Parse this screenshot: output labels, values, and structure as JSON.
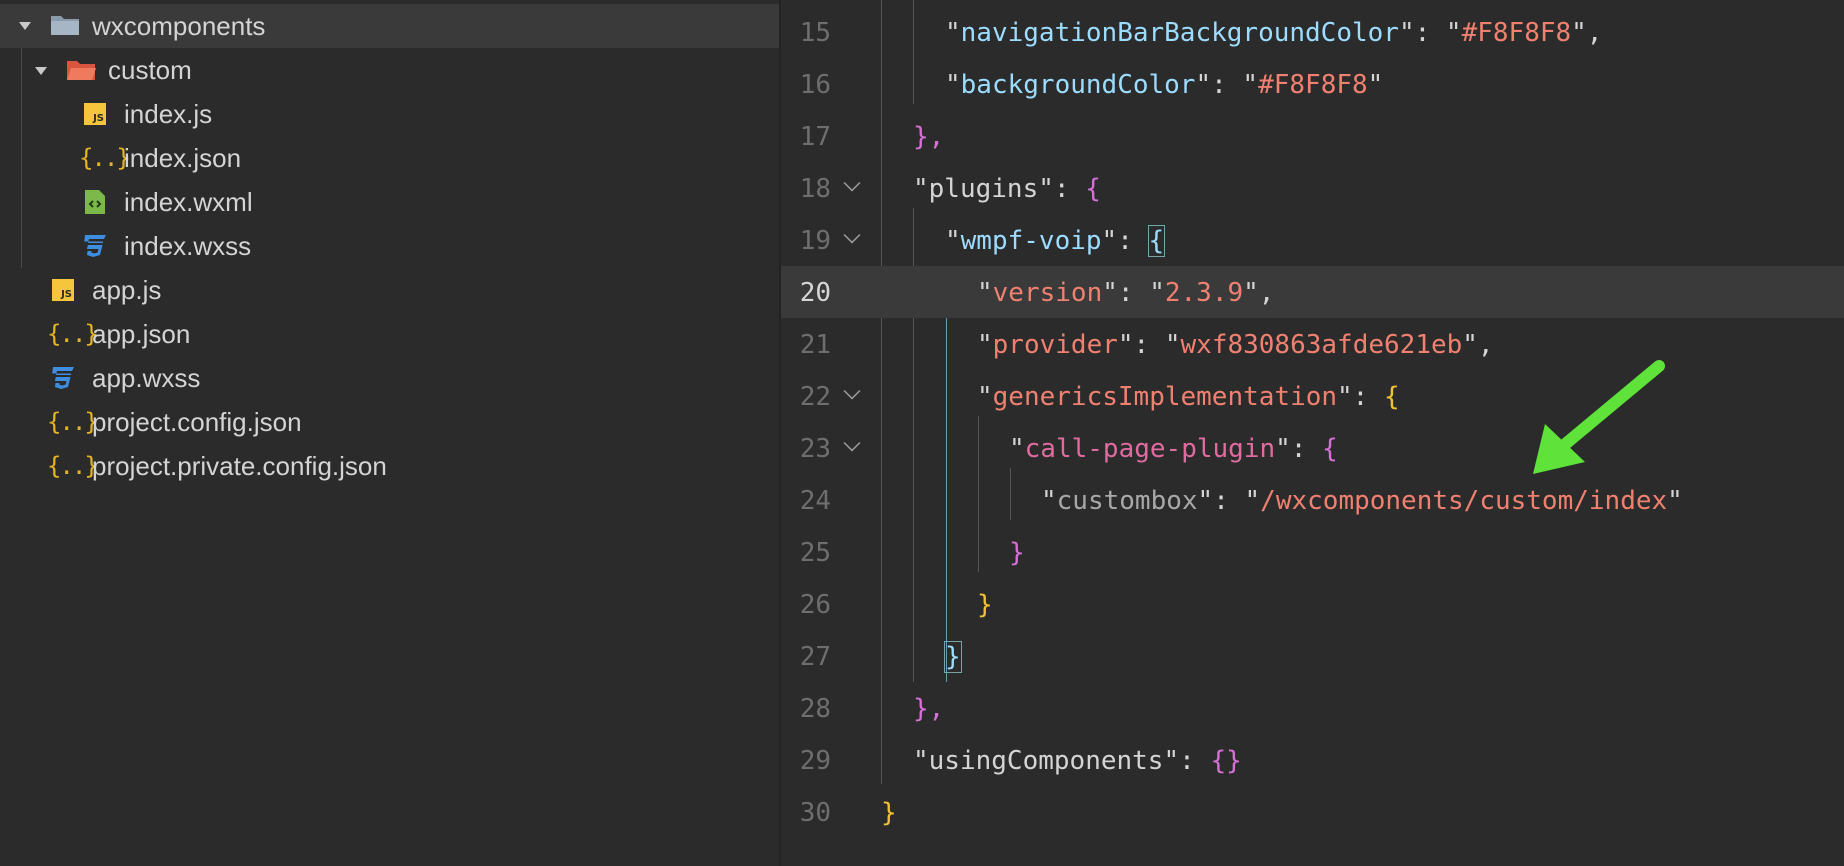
{
  "explorer": {
    "items": [
      {
        "label": "wxcomponents",
        "icon": "folder-icon",
        "expanded": true
      },
      {
        "label": "custom",
        "icon": "folder-open-icon",
        "expanded": true
      },
      {
        "label": "index.js",
        "icon": "js-file-icon"
      },
      {
        "label": "index.json",
        "icon": "json-file-icon"
      },
      {
        "label": "index.wxml",
        "icon": "wxml-file-icon"
      },
      {
        "label": "index.wxss",
        "icon": "css-file-icon"
      },
      {
        "label": "app.js",
        "icon": "js-file-icon"
      },
      {
        "label": "app.json",
        "icon": "json-file-icon"
      },
      {
        "label": "app.wxss",
        "icon": "css-file-icon"
      },
      {
        "label": "project.config.json",
        "icon": "json-file-icon"
      },
      {
        "label": "project.private.config.json",
        "icon": "json-file-icon"
      }
    ],
    "js_badge": "JS",
    "json_glyph": "{..}"
  },
  "editor": {
    "current_line": "20",
    "lines": [
      {
        "n": "15",
        "parts": [
          "\"",
          "navigationBarBackgroundColor",
          "\": \"",
          "#F8F8F8",
          "\","
        ]
      },
      {
        "n": "16",
        "parts": [
          "\"",
          "backgroundColor",
          "\": \"",
          "#F8F8F8",
          "\""
        ]
      },
      {
        "n": "17",
        "parts": [
          "},"
        ]
      },
      {
        "n": "18",
        "parts": [
          "\"",
          "plugins",
          "\": ",
          "{"
        ]
      },
      {
        "n": "19",
        "parts": [
          "\"",
          "wmpf-voip",
          "\": ",
          "{"
        ]
      },
      {
        "n": "20",
        "parts": [
          "\"",
          "version",
          "\": \"",
          "2.3.9",
          "\","
        ]
      },
      {
        "n": "21",
        "parts": [
          "\"",
          "provider",
          "\": \"",
          "wxf830863afde621eb",
          "\","
        ]
      },
      {
        "n": "22",
        "parts": [
          "\"",
          "genericsImplementation",
          "\": ",
          "{"
        ]
      },
      {
        "n": "23",
        "parts": [
          "\"",
          "call-page-plugin",
          "\": ",
          "{"
        ]
      },
      {
        "n": "24",
        "parts": [
          "\"",
          "custombox",
          "\": \"",
          "/wxcomponents/custom/index",
          "\""
        ]
      },
      {
        "n": "25",
        "parts": [
          "}"
        ]
      },
      {
        "n": "26",
        "parts": [
          "}"
        ]
      },
      {
        "n": "27",
        "parts": [
          "}"
        ]
      },
      {
        "n": "28",
        "parts": [
          "},"
        ]
      },
      {
        "n": "29",
        "parts": [
          "\"",
          "usingComponents",
          "\": ",
          "{}"
        ]
      },
      {
        "n": "30",
        "parts": [
          "}"
        ]
      }
    ]
  },
  "colors": {
    "background": "#2b2b2b",
    "selection": "#3a3a3a",
    "arrow_annotation": "#5fe33a",
    "string": "#f08070",
    "key": "#9cdcfe"
  }
}
